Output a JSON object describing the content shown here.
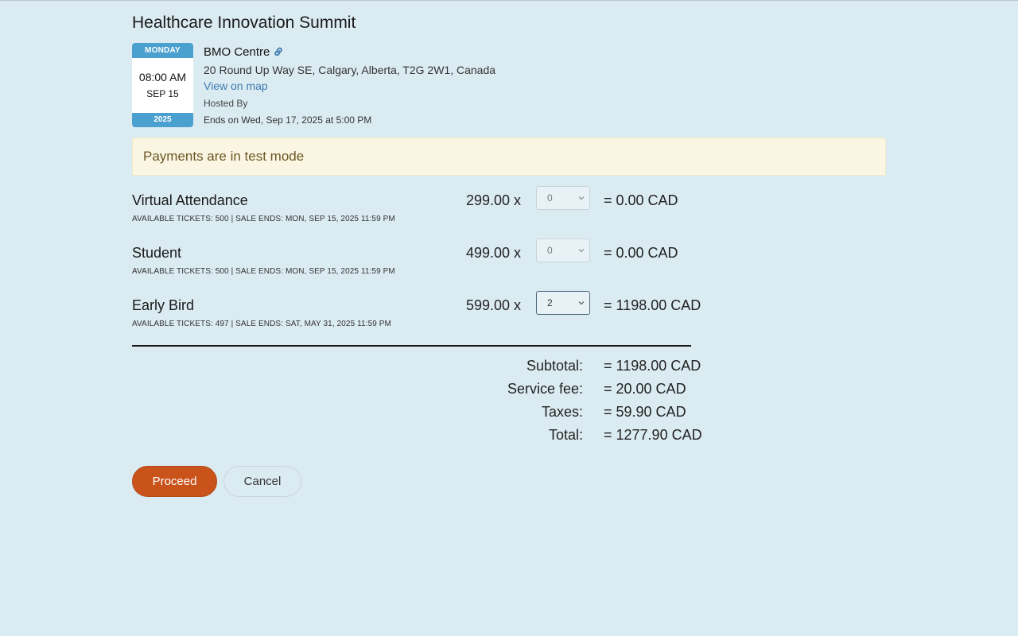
{
  "event": {
    "title": "Healthcare Innovation Summit",
    "calendar": {
      "day": "MONDAY",
      "time": "08:00 AM",
      "date": "SEP 15",
      "year": "2025"
    },
    "venue": {
      "name": "BMO Centre",
      "address": "20 Round Up Way SE, Calgary, Alberta, T2G 2W1, Canada",
      "map_link": "View on map",
      "hosted_by": "Hosted By",
      "ends_on": "Ends on  Wed, Sep 17, 2025 at 5:00 PM"
    }
  },
  "alert": {
    "text": "Payments are in test mode"
  },
  "tickets": [
    {
      "name": "Virtual Attendance",
      "meta": "AVAILABLE TICKETS: 500 | SALE ENDS: MON, SEP 15, 2025 11:59 PM",
      "price": "299.00 x",
      "qty": "0",
      "total": "= 0.00 CAD"
    },
    {
      "name": "Student",
      "meta": "AVAILABLE TICKETS: 500 | SALE ENDS: MON, SEP 15, 2025 11:59 PM",
      "price": "499.00 x",
      "qty": "0",
      "total": "= 0.00 CAD"
    },
    {
      "name": "Early Bird",
      "meta": "AVAILABLE TICKETS: 497 | SALE ENDS: SAT, MAY 31, 2025 11:59 PM",
      "price": "599.00 x",
      "qty": "2",
      "total": "= 1198.00 CAD"
    }
  ],
  "summary": {
    "subtotal_label": "Subtotal:",
    "subtotal": "= 1198.00 CAD",
    "fee_label": "Service fee:",
    "fee": "= 20.00 CAD",
    "taxes_label": "Taxes:",
    "taxes": "= 59.90 CAD",
    "total_label": "Total:",
    "total": "= 1277.90 CAD"
  },
  "actions": {
    "proceed": "Proceed",
    "cancel": "Cancel"
  },
  "colors": {
    "background": "#dbebf2",
    "accent": "#4aa0cf",
    "proceed": "#c9531b",
    "link": "#3d7bb0",
    "alert_bg": "#fbf6e3"
  },
  "icons": {
    "venue_link": "link-icon",
    "select_arrow": "chevron-down-icon"
  }
}
